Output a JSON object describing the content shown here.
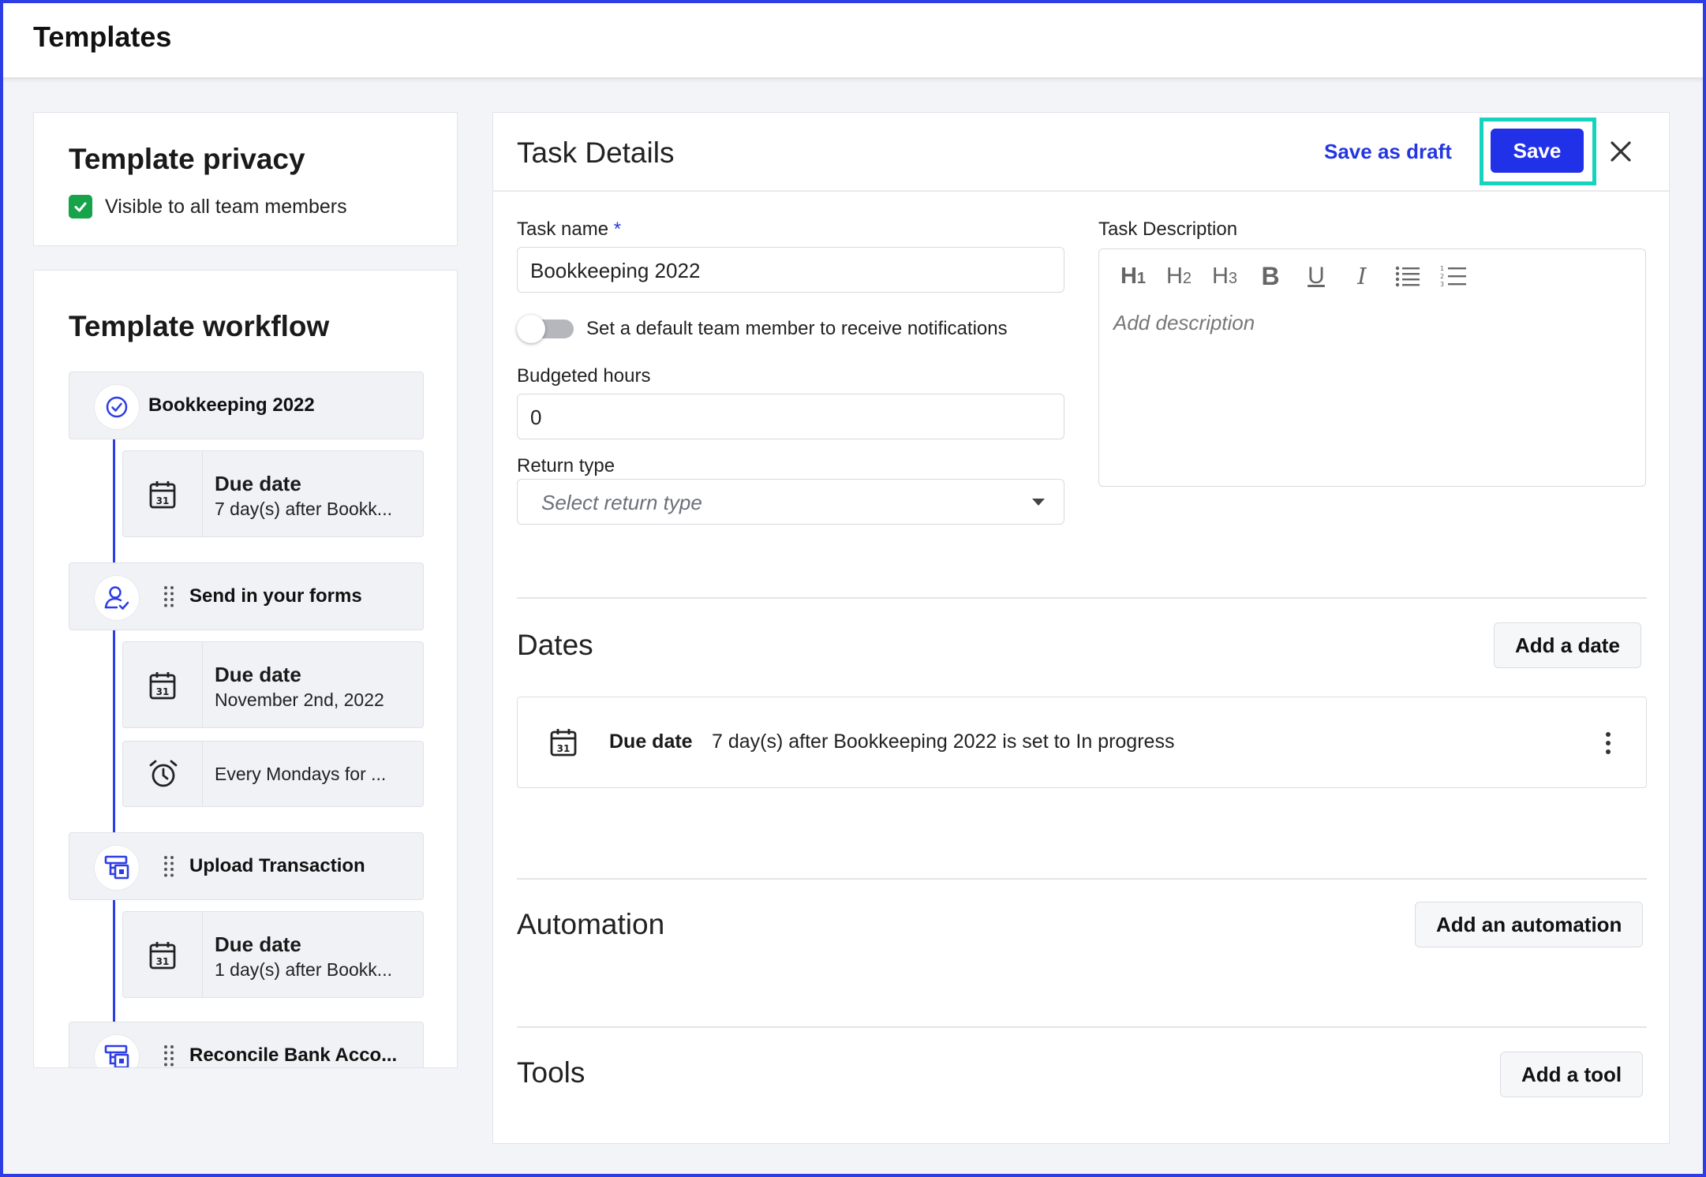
{
  "header": {
    "title": "Templates"
  },
  "privacy": {
    "title": "Template privacy",
    "checkbox_label": "Visible to all team members",
    "checked": true
  },
  "workflow": {
    "title": "Template workflow",
    "tasks": [
      {
        "label": "Bookkeeping 2022",
        "icon": "check-circle-icon"
      },
      {
        "label": "Send in your forms",
        "icon": "user-check-icon"
      },
      {
        "label": "Upload Transaction",
        "icon": "workflow-icon"
      },
      {
        "label": "Reconcile Bank Acco...",
        "icon": "workflow-icon"
      }
    ],
    "subitems": [
      {
        "title": "Due date",
        "text": "7 day(s) after Bookk...",
        "icon": "calendar-icon"
      },
      {
        "title": "Due date",
        "text": "November 2nd, 2022",
        "icon": "calendar-icon"
      },
      {
        "title": "",
        "text": "Every Mondays for ...",
        "icon": "alarm-clock-icon"
      },
      {
        "title": "Due date",
        "text": "1 day(s) after Bookk...",
        "icon": "calendar-icon"
      }
    ]
  },
  "panel": {
    "title": "Task Details",
    "save_draft_label": "Save as draft",
    "save_label": "Save",
    "accent": "#2131e8",
    "focus_color": "#16d3c0"
  },
  "form": {
    "task_name_label": "Task name",
    "required_mark": "*",
    "task_name_value": "Bookkeeping 2022",
    "toggle_label": "Set a default team member to receive notifications",
    "toggle_on": false,
    "budget_label": "Budgeted hours",
    "budget_value": "0",
    "return_type_label": "Return type",
    "return_type_placeholder": "Select return type",
    "description_label": "Task Description",
    "description_placeholder": "Add description",
    "toolbar": [
      "H1",
      "H2",
      "H3",
      "bold",
      "underline",
      "italic",
      "bullet-list",
      "numbered-list"
    ]
  },
  "dates": {
    "title": "Dates",
    "add_label": "Add a date",
    "row": {
      "title": "Due date",
      "text": "7 day(s) after Bookkeeping 2022 is set to In progress"
    }
  },
  "automation": {
    "title": "Automation",
    "add_label": "Add an automation"
  },
  "tools": {
    "title": "Tools",
    "add_label": "Add a tool"
  }
}
